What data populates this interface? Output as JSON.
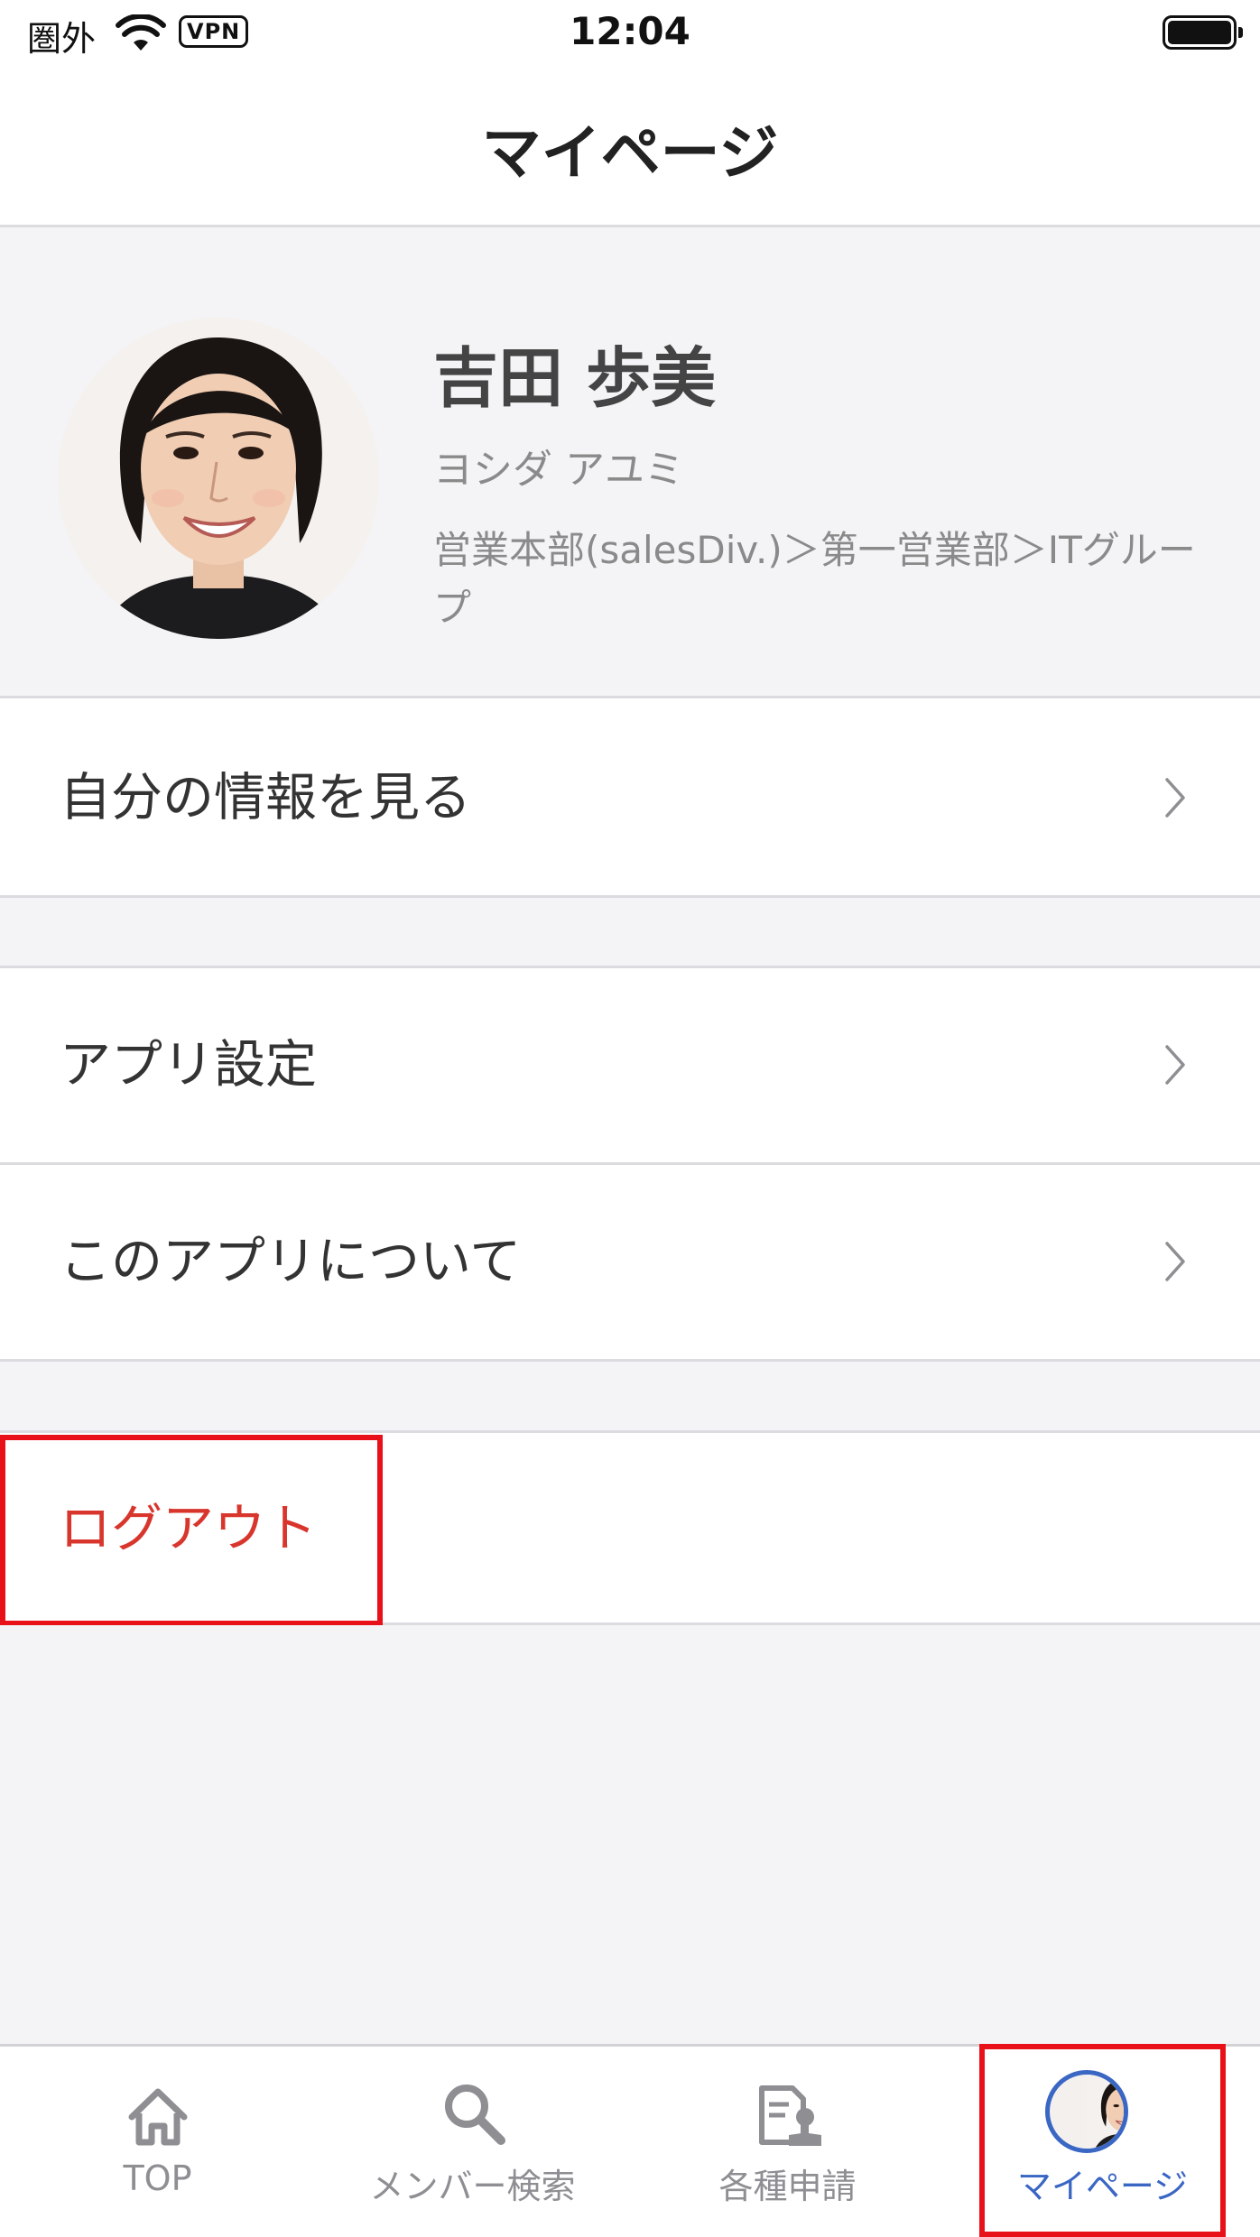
{
  "status_bar": {
    "carrier": "圏外",
    "vpn": "VPN",
    "time": "12:04"
  },
  "nav": {
    "title": "マイページ"
  },
  "profile": {
    "name": "吉田 歩美",
    "kana": "ヨシダ アユミ",
    "department": "営業本部(salesDiv.)＞第一営業部＞ITグループ"
  },
  "menu": {
    "my_info": "自分の情報を見る",
    "app_settings": "アプリ設定",
    "about_app": "このアプリについて",
    "logout": "ログアウト"
  },
  "tabs": [
    {
      "label": "TOP",
      "icon": "home-icon"
    },
    {
      "label": "メンバー検索",
      "icon": "search-icon"
    },
    {
      "label": "各種申請",
      "icon": "stamp-document-icon"
    },
    {
      "label": "マイページ",
      "icon": "avatar-icon",
      "active": true
    }
  ],
  "colors": {
    "accent": "#3a66c4",
    "logout": "#d8362d",
    "highlight_box": "#e8111a",
    "grouped_background": "#f4f4f7"
  }
}
